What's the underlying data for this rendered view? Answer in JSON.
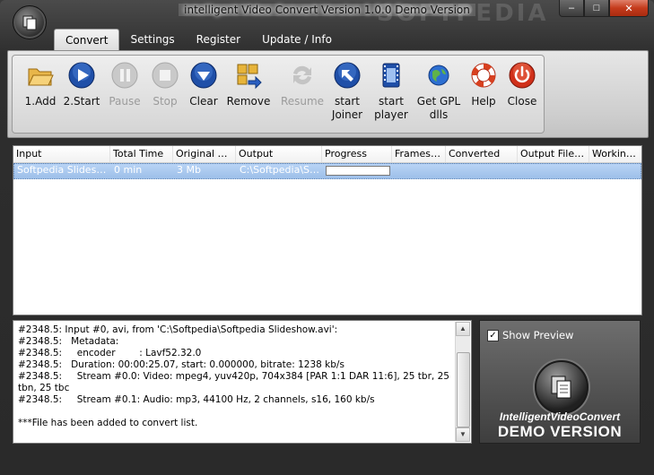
{
  "window": {
    "title": "intelligent Video Convert Version 1.0.0 Demo Version",
    "watermark": "SOFTPEDIA"
  },
  "tabs": [
    {
      "label": "Convert",
      "active": true
    },
    {
      "label": "Settings"
    },
    {
      "label": "Register"
    },
    {
      "label": "Update / Info"
    }
  ],
  "toolbar": {
    "add_label": "1.Add",
    "start_label": "2.Start",
    "pause_label": "Pause",
    "stop_label": "Stop",
    "clear_label": "Clear",
    "remove_label": "Remove",
    "resume_label": "Resume",
    "joiner_label_1": "start",
    "joiner_label_2": "Joiner",
    "player_label_1": "start",
    "player_label_2": "player",
    "gpl_label_1": "Get GPL",
    "gpl_label_2": "dlls",
    "help_label": "Help",
    "close_label": "Close"
  },
  "grid": {
    "columns": [
      "Input",
      "Total Time",
      "Original Fil...",
      "Output",
      "Progress",
      "Frames p...",
      "Converted",
      "Output File Size",
      "Working..."
    ],
    "rows": [
      {
        "input": "Softpedia Slideshow....",
        "total_time": "0 min",
        "original_size": "3 Mb",
        "output": "C:\\Softpedia\\So..."
      }
    ]
  },
  "log": {
    "lines": [
      "#2348.5: Input #0, avi, from 'C:\\Softpedia\\Softpedia Slideshow.avi':",
      "#2348.5:   Metadata:",
      "#2348.5:     encoder        : Lavf52.32.0",
      "#2348.5:   Duration: 00:00:25.07, start: 0.000000, bitrate: 1238 kb/s",
      "#2348.5:     Stream #0.0: Video: mpeg4, yuv420p, 704x384 [PAR 1:1 DAR 11:6], 25 tbr, 25 tbn, 25 tbc",
      "#2348.5:     Stream #0.1: Audio: mp3, 44100 Hz, 2 channels, s16, 160 kb/s",
      "",
      "***File has been added to convert list."
    ]
  },
  "preview": {
    "show_preview_label": "Show Preview",
    "show_preview_checked": true,
    "brand": "IntelligentVideoConvert",
    "demo_label": "DEMO VERSION"
  },
  "colors": {
    "selection": "#9dbfe9",
    "close_button": "#c43b1c"
  }
}
